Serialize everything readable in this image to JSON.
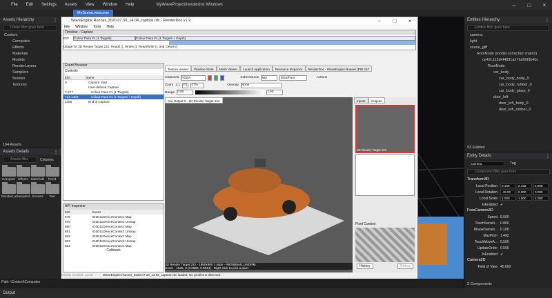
{
  "menubar": {
    "file": "File",
    "edit": "Edit",
    "settings": "Settings",
    "assets": "Assets",
    "view": "View",
    "window": "Window",
    "help": "Help",
    "title": "MyWaveProject/renderdoc Windows"
  },
  "scene_tab": "MyScene.wescene",
  "assets_hierarchy": {
    "title": "Assets Hierarchy",
    "filter": "Folder filter goes here",
    "items": [
      "Content",
      "Computes",
      "Effects",
      "Materials",
      "Models",
      "RenderLayers",
      "Samplers",
      "Scenes",
      "Textures"
    ],
    "count": "164 Assets"
  },
  "assets_details": {
    "title": "Assets Details",
    "filter": "Assets filter",
    "columns": "Columns",
    "folders": [
      "Compute",
      "Effects",
      "Materials",
      "Rend",
      "RenderLa",
      "Samplers",
      "Scenes",
      "Text"
    ]
  },
  "path_label": "Path: \\Content\\Computes",
  "output_label": "Output",
  "entities_hierarchy": {
    "title": "Entities Hierarchy",
    "filter": "Entities filter goes here",
    "items": [
      "camera",
      "light",
      "scene_gltf",
      "RootNode (model correction matrix)",
      "ce42c113d4f4831a27fa0999b4bc",
      "RootNode",
      "car_body",
      "car_body_body_0",
      "car_body_rubber_0",
      "car_body_glass_0",
      "door_left",
      "door_left_body_0",
      "door_left_rubber_0"
    ],
    "count": "93 Entities"
  },
  "entity_details": {
    "title": "Entity Details",
    "name": "camera",
    "tag": "Tag",
    "filter": "Component filter goes here",
    "transform": "Transform3D",
    "local_position": {
      "label": "Local Position",
      "x": "0.199",
      "y": "2.168",
      "z": "2.508"
    },
    "local_rotation": {
      "label": "Local Rotation",
      "x": "-45.00",
      "y": "0.000",
      "z": "0.000"
    },
    "local_scale": {
      "label": "Local Scale",
      "x": "1.000",
      "y": "1.000",
      "z": "1.000"
    },
    "is_enabled": "IsEnabled",
    "freecamera": "FreeCamera3D",
    "speed": {
      "label": "Speed",
      "value": "5.000"
    },
    "touch_sens": {
      "label": "TouchSensiti...",
      "value": "0.800"
    },
    "mouse_sens": {
      "label": "MouseSensiti...",
      "value": "0.100"
    },
    "max_pitch": {
      "label": "MaxPitch",
      "value": "1.492"
    },
    "touch_move": {
      "label": "TouchMoveA...",
      "value": "0.500"
    },
    "update_order": {
      "label": "UpdateOrder",
      "value": "0.500"
    },
    "is_enabled2": "IsEnabled",
    "camera3d": "Camera3D",
    "fov": {
      "label": "Field of View",
      "value": "45.000"
    },
    "components": "3 Components"
  },
  "renderdoc": {
    "title": "WaveEngine.Runner_2020.07.30_14.04_capture.rdc - RenderDoc v1.9",
    "menu": [
      "File",
      "Window",
      "Tools",
      "Help"
    ],
    "timeline": "Timeline - Capture",
    "eid": "EID",
    "colour_pass_label": "Colour Pass #1 (1 Targets)",
    "colour_pass_label2": "Colour Pass #1 (1 Targets + Depth)",
    "usage": "Usage for 3D Render Target 222: Reads (), Writes (), Read/Write (), and Clears ()",
    "event_browser": "Event Browser",
    "controls": "Controls",
    "eid_col": "EID",
    "name_col": "Name",
    "events": [
      {
        "eid": "0",
        "name": "Capture Start"
      },
      {
        "eid": "",
        "name": "User-defined Capture"
      },
      {
        "eid": "7-677",
        "name": "Colour Pass #1 (1 Targets)"
      },
      {
        "eid": "714-1453",
        "name": "Colour Pass #1 (1 Targets + Depth)"
      },
      {
        "eid": "1455",
        "name": "End of Capture"
      }
    ],
    "api_inspector": "API Inspector",
    "api_eid": "EID",
    "api_event": "Event",
    "api_rows": [
      {
        "eid": "678",
        "event": "ID3D11DeviceContext::Map"
      },
      {
        "eid": "679",
        "event": "ID3D11DeviceContext::Unmap"
      },
      {
        "eid": "680",
        "event": "ID3D11DeviceContext::Map"
      },
      {
        "eid": "681",
        "event": "ID3D11DeviceContext::Unmap"
      },
      {
        "eid": "682",
        "event": "ID3D11DeviceContext::Map"
      },
      {
        "eid": "683",
        "event": "ID3D11DeviceContext::Unmap"
      },
      {
        "eid": "684",
        "event": "ID3D11DeviceContext::Map"
      }
    ],
    "callstack": "Callstack",
    "tabs": [
      "Texture Viewer",
      "Pipeline State",
      "Mesh Viewer",
      "Launch Application",
      "Resource Inspector",
      "RenderDoc - WaveEngine.Runner [PID 157"
    ],
    "channels": "Channels",
    "channels_val": "RGBA",
    "mip": "Subresource",
    "mip_val": "Mip",
    "slice": "Slice/Face",
    "actions": "Actions",
    "zoom": "Zoom",
    "zoom_val": "1:1",
    "fit": "Fit",
    "pct": "47%",
    "overlay": "Overlay",
    "overlay_val": "None",
    "range": "Range",
    "range_min": "0.00",
    "range_max": "1.00",
    "car_output_tab": "Car Output 0 - 2D Render Target 222",
    "inputs": "Inputs",
    "outputs": "Outputs",
    "thumb1": "2D Render Target 222",
    "thumb2": "",
    "pixel_context": "Pixel Context",
    "history": "History",
    "debug": "Debug",
    "status1": "2D Render Target 222 - 1950x900 1 mips - R8G8B8A8_UNORM",
    "status2": "Hover - 1525, 0 (0.9659, 0.0044) - Right click to pick a pixel",
    "footer": "WaveEngine.Runner_2020.07.30_14.04_capture.rdc loaded. No problems detected.",
    "replay": "Replay Context: Local"
  }
}
